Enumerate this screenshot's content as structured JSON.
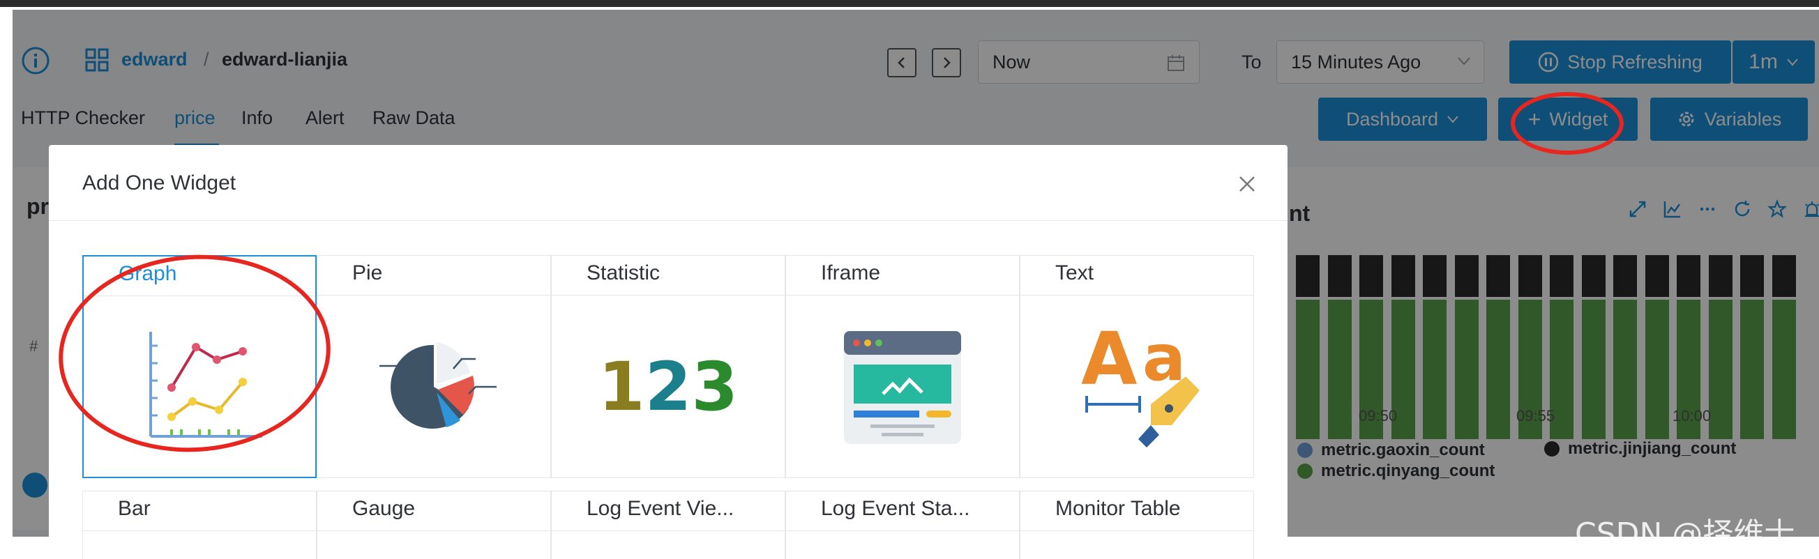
{
  "breadcrumb": {
    "parent": "edward",
    "separator": "/",
    "current": "edward-lianjia"
  },
  "time": {
    "from": "Now",
    "to_label": "To",
    "to": "15 Minutes Ago"
  },
  "refresh": {
    "stop_label": "Stop Refreshing",
    "interval": "1m"
  },
  "tabs": [
    "HTTP Checker",
    "price",
    "Info",
    "Alert",
    "Raw Data"
  ],
  "toolbar": {
    "dashboard_label": "Dashboard",
    "widget_label": "Widget",
    "variables_label": "Variables"
  },
  "left_panel": {
    "title_fragment": "pr",
    "hash": "#"
  },
  "right_panel": {
    "title_fragment": "nt",
    "x_ticks": [
      "09:50",
      "09:55",
      "10:00"
    ],
    "legend": [
      {
        "name": "metric.gaoxin_count",
        "color": "#6fa0d8"
      },
      {
        "name": "metric.jinjiang_count",
        "color": "#2a2a2a"
      },
      {
        "name": "metric.qinyang_count",
        "color": "#5aa04a"
      }
    ]
  },
  "modal": {
    "title": "Add One Widget",
    "widgets_row1": [
      "Graph",
      "Pie",
      "Statistic",
      "Iframe",
      "Text"
    ],
    "widgets_row2": [
      "Bar",
      "Gauge",
      "Log Event Vie...",
      "Log Event Sta...",
      "Monitor Table"
    ],
    "selected": "Graph",
    "statistic_sample": {
      "d1": "1",
      "d2": "2",
      "d3": "3"
    },
    "text_sample": {
      "upper": "A",
      "lower": "a"
    }
  },
  "watermark": "CSDN @择维士",
  "colors": {
    "accent": "#1c8fd8",
    "annotation": "#e6261f"
  }
}
